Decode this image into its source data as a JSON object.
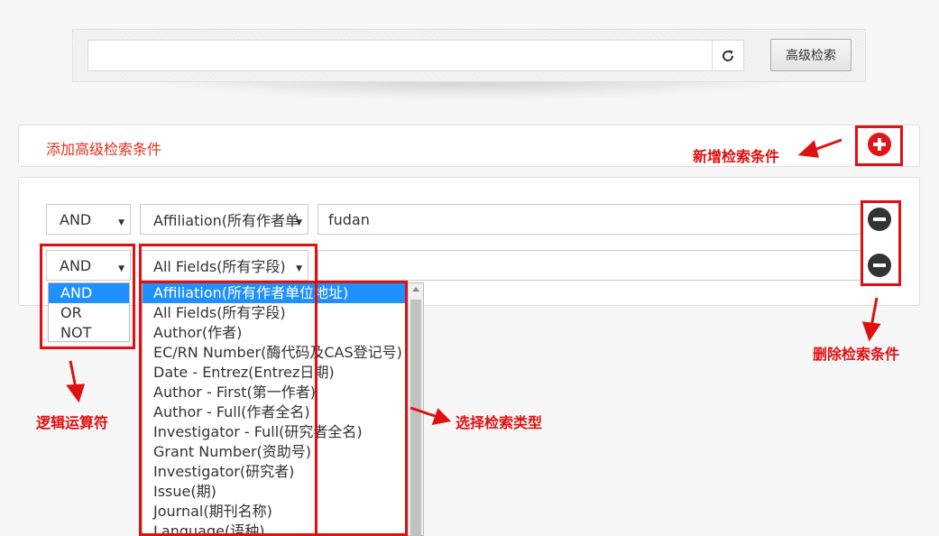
{
  "top_search": {
    "input_value": "",
    "advanced_button": "高级检索",
    "refresh_icon": "refresh-icon"
  },
  "add_panel": {
    "title": "添加高级检索条件",
    "add_icon": "plus-circle-icon"
  },
  "rows": [
    {
      "logic": "AND",
      "field": "Affiliation(所有作者单",
      "value": "fudan",
      "remove_icon": "minus-circle-icon"
    },
    {
      "logic": "AND",
      "field": "All Fields(所有字段)",
      "value": "",
      "remove_icon": "minus-circle-icon"
    }
  ],
  "logic_options": [
    "AND",
    "OR",
    "NOT"
  ],
  "logic_selected_index": 0,
  "field_options": [
    "Affiliation(所有作者单位地址)",
    "All Fields(所有字段)",
    "Author(作者)",
    "EC/RN Number(酶代码及CAS登记号)",
    "Date - Entrez(Entrez日期)",
    "Author - First(第一作者)",
    "Author - Full(作者全名)",
    "Investigator - Full(研究者全名)",
    "Grant Number(资助号)",
    "Investigator(研究者)",
    "Issue(期)",
    "Journal(期刊名称)",
    "Language(语种)"
  ],
  "field_selected_index": 0,
  "annotations": {
    "add_condition": "新增检索条件",
    "remove_condition": "删除检索条件",
    "logic_operator": "逻辑运算符",
    "select_field_type": "选择检索类型"
  },
  "colors": {
    "annotation_red": "#e01010",
    "title_red": "#e0301e",
    "highlight_blue": "#1e90ff"
  }
}
